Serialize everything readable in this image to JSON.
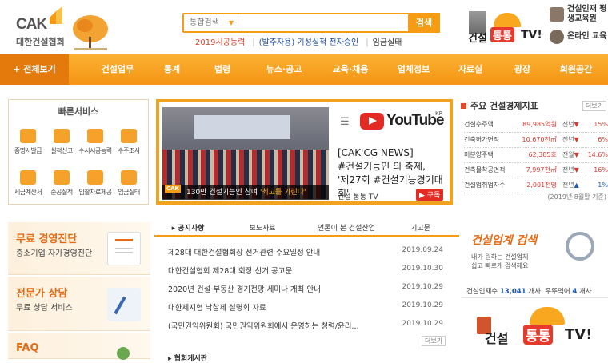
{
  "header": {
    "logo_abbr": "CAK",
    "logo_org": "대한건설협회",
    "search": {
      "select_value": "통합검색",
      "button": "검색"
    },
    "quick_links": [
      "2019시공능력",
      "(발주자용) 기성실적 전자승인",
      "임금실태"
    ],
    "tv_logo": {
      "part1": "건설",
      "part2": "통통",
      "part3": "TV!"
    },
    "side_links": [
      "건설인재 평생교육원",
      "온라인 교육"
    ]
  },
  "nav": {
    "all_label": "+ 전체보기",
    "items": [
      "건설업무",
      "통계",
      "법령",
      "뉴스·공고",
      "교육·채용",
      "업체정보",
      "자료실",
      "광장",
      "회원공간"
    ]
  },
  "quick_services": {
    "title": "빠른서비스",
    "items": [
      "증명서발급",
      "실적신고",
      "수시시공능력",
      "수주조사",
      "세금계산서",
      "준공실적",
      "입찰자료제공",
      "임금실태"
    ]
  },
  "youtube_banner": {
    "photo_caption_prefix": "130만 건설기능인 참여",
    "photo_caption_highlight": "'최고를 가린다'",
    "photo_tag": "CAK",
    "brand": "YouTube",
    "brand_region": "KR",
    "text_lines": [
      "[CAK'CG NEWS]",
      "#건설기능인 의 축제,",
      "'제27회 #건설기능경기대회'"
    ],
    "channel": "건설 통통 TV",
    "subscribe": "구독"
  },
  "economy": {
    "title": "주요 건설경제지표",
    "more": "더보기",
    "rows": [
      {
        "label": "건설수주액",
        "value": "89,985억원",
        "period": "전년",
        "change": "15%",
        "dir": "down"
      },
      {
        "label": "건축허가면적",
        "value": "10,670천㎡",
        "period": "전년",
        "change": "6%",
        "dir": "down"
      },
      {
        "label": "미분양주택",
        "value": "62,385호",
        "period": "전월",
        "change": "14.6%",
        "dir": "down"
      },
      {
        "label": "건축물착공면적",
        "value": "7,997천㎡",
        "period": "전년",
        "change": "16%",
        "dir": "down"
      },
      {
        "label": "건설업취업자수",
        "value": "2,001천명",
        "period": "전년",
        "change": "1%",
        "dir": "up"
      }
    ],
    "note": "(2019년 8월말 기준)"
  },
  "left_panels": [
    {
      "title": "무료 경영진단",
      "subtitle": "중소기업 자가경영진단"
    },
    {
      "title": "전문가 상담",
      "subtitle": "무료 상담 서비스"
    },
    {
      "title": "FAQ",
      "subtitle": ""
    }
  ],
  "notice": {
    "tabs": [
      "공지사항",
      "보도자료",
      "언론이 본 건설산업",
      "기고문"
    ],
    "rows": [
      {
        "title": "제28대 대한건설협회장 선거관련 주요일정 안내",
        "date": "2019.09.24"
      },
      {
        "title": "대한건설협회 제28대 회장 선거 공고문",
        "date": "2019.10.30"
      },
      {
        "title": "2020년 건설·부동산 경기전망 세미나 개최 안내",
        "date": "2019.10.29"
      },
      {
        "title": "대한제지협 낙찰제 설명회 자료",
        "date": "2019.10.29"
      },
      {
        "title": "(국민권익위원회) 국민권익위원회에서 운영하는 청렴/윤리...",
        "date": "2019.10.29"
      }
    ],
    "more": "더보기",
    "next_section": "협회게시판"
  },
  "job_search": {
    "title": "건설업계 검색",
    "sub_lines": [
      "내가 원하는 건설업체",
      "쉽고 빠르게 검색해요"
    ],
    "stat_prefix": "건설인재수",
    "stat_count": "13,041",
    "stat_unit": "개사",
    "stat2_prefix": "우뚜먹어",
    "stat2_count": "4",
    "stat2_unit": "개사"
  },
  "colors": {
    "brand_orange": "#f59b14",
    "accent_red": "#e63a2c",
    "blue": "#1e5ab6"
  }
}
